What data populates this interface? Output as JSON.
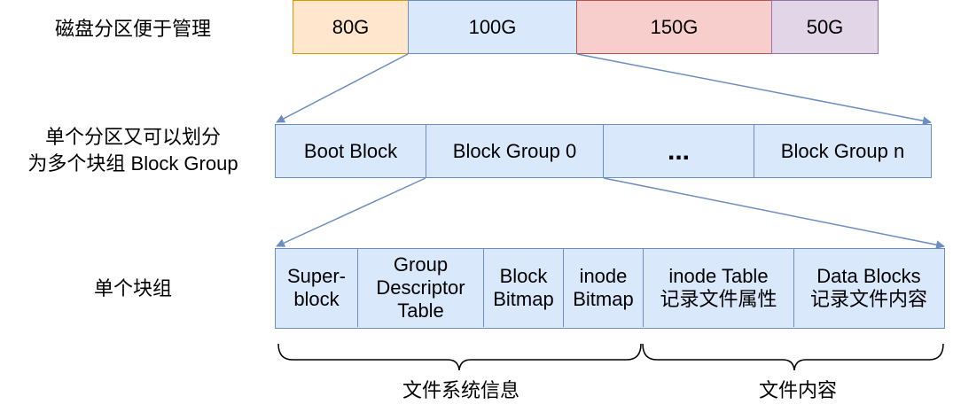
{
  "labels": {
    "disk": "磁盘分区便于管理",
    "partition_line1": "单个分区又可以划分",
    "partition_line2": "为多个块组 Block Group",
    "single_group": "单个块组",
    "fs_info": "文件系统信息",
    "file_content": "文件内容"
  },
  "disk_partitions": [
    {
      "label": "80G",
      "fill": "#ffe6cc",
      "stroke": "#d79b00"
    },
    {
      "label": "100G",
      "fill": "#dae8fc",
      "stroke": "#6c8ebf"
    },
    {
      "label": "150G",
      "fill": "#f8cecc",
      "stroke": "#b85450"
    },
    {
      "label": "50G",
      "fill": "#e1d5e7",
      "stroke": "#9673a6"
    }
  ],
  "partition_blocks": [
    "Boot Block",
    "Block Group 0",
    "...",
    "Block Group n"
  ],
  "group_cells": [
    {
      "line1": "Super-",
      "line2": "block",
      "line3": ""
    },
    {
      "line1": "Group",
      "line2": "Descriptor",
      "line3": "Table"
    },
    {
      "line1": "Block",
      "line2": "Bitmap",
      "line3": ""
    },
    {
      "line1": "inode",
      "line2": "Bitmap",
      "line3": ""
    },
    {
      "line1": "inode Table",
      "line2": "记录文件属性",
      "line3": ""
    },
    {
      "line1": "Data Blocks",
      "line2": "记录文件内容",
      "line3": ""
    }
  ],
  "colors": {
    "accent_stroke": "#6c8ebf",
    "accent_fill": "#dae8fc"
  }
}
